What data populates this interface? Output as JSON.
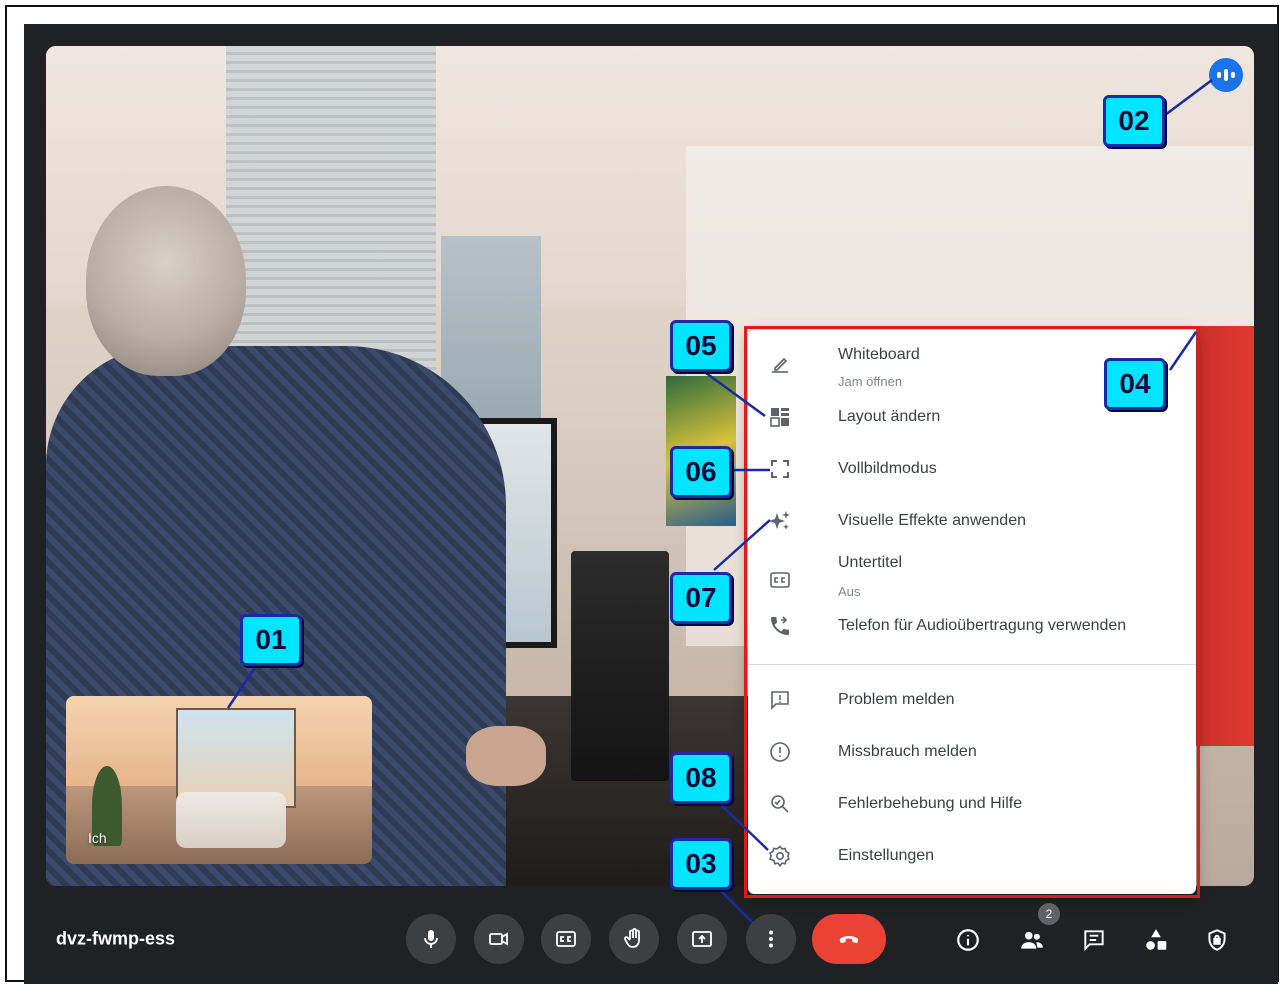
{
  "meeting": {
    "code": "dvz-fwmp-ess"
  },
  "self_view": {
    "label": "Ich"
  },
  "menu": {
    "items": [
      {
        "label": "Whiteboard",
        "sub": "Jam öffnen",
        "icon": "pencil-icon"
      },
      {
        "label": "Layout ändern",
        "icon": "layout-icon"
      },
      {
        "label": "Vollbildmodus",
        "icon": "fullscreen-icon"
      },
      {
        "label": "Visuelle Effekte anwenden",
        "icon": "sparkle-icon"
      },
      {
        "label": "Untertitel",
        "sub": "Aus",
        "icon": "captions-icon"
      },
      {
        "label": "Telefon für Audioübertragung verwenden",
        "icon": "phone-forward-icon"
      },
      {
        "label": "Problem melden",
        "icon": "report-problem-icon"
      },
      {
        "label": "Missbrauch melden",
        "icon": "report-abuse-icon"
      },
      {
        "label": "Fehlerbehebung und Hilfe",
        "icon": "troubleshoot-icon"
      },
      {
        "label": "Einstellungen",
        "icon": "gear-icon"
      }
    ]
  },
  "callouts": [
    "01",
    "02",
    "03",
    "04",
    "05",
    "06",
    "07",
    "08"
  ],
  "controls": {
    "participants_count": "2"
  },
  "colors": {
    "background": "#202124",
    "control": "#3c4043",
    "end_call": "#ea4335",
    "accent": "#1a73e8",
    "badge_fill": "#00e5ff",
    "highlight": "#e01b1b"
  }
}
